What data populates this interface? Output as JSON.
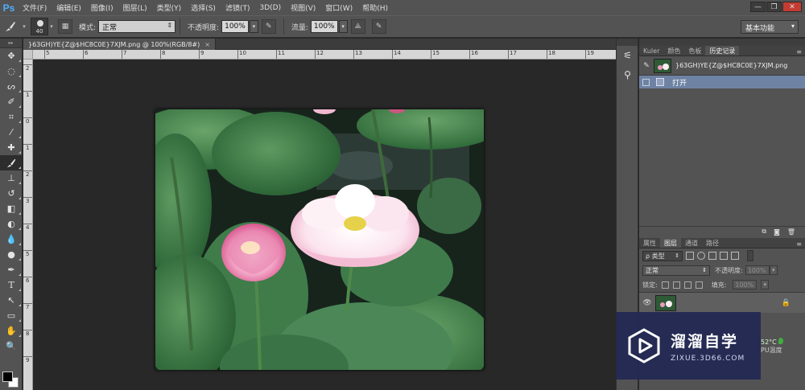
{
  "app": {
    "logo": "Ps"
  },
  "menu": {
    "items": [
      "文件(F)",
      "编辑(E)",
      "图像(I)",
      "图层(L)",
      "类型(Y)",
      "选择(S)",
      "滤镜(T)",
      "3D(D)",
      "视图(V)",
      "窗口(W)",
      "帮助(H)"
    ]
  },
  "window_controls": {
    "minimize": "—",
    "restore": "❐",
    "close": "✕"
  },
  "options_bar": {
    "brush_size": "40",
    "mode_label": "模式:",
    "mode_value": "正常",
    "opacity_label": "不透明度:",
    "opacity_value": "100%",
    "flow_label": "流量:",
    "flow_value": "100%",
    "workspace": "基本功能"
  },
  "document": {
    "tab_title": "}63GH)YE{Z@$HC8C0E}7XJM.png @ 100%(RGB/8#)",
    "tab_close": "×",
    "ruler_h": [
      "5",
      "6",
      "7",
      "8",
      "9",
      "10",
      "11",
      "12",
      "13",
      "14",
      "15",
      "16",
      "17",
      "18",
      "19"
    ],
    "ruler_v": [
      "2",
      "1",
      "0",
      "1",
      "2",
      "3",
      "4",
      "5",
      "6",
      "7",
      "8",
      "9"
    ]
  },
  "history_panel": {
    "tabs": [
      "Kuler",
      "颜色",
      "色板",
      "历史记录"
    ],
    "active_tab": "历史记录",
    "snapshot_name": "}63GH)YE{Z@$HC8C0E}7XJM.png",
    "steps": [
      "打开"
    ]
  },
  "layers_panel": {
    "tabs": [
      "属性",
      "图层",
      "通道",
      "路径"
    ],
    "active_tab": "图层",
    "kind_filter": "ρ 类型",
    "blend_mode": "正常",
    "opacity_label": "不透明度:",
    "opacity_value": "100%",
    "lock_label": "锁定:",
    "fill_label": "填充:",
    "fill_value": "100%"
  },
  "watermark": {
    "title": "溜溜自学",
    "subtitle": "ZIXUE.3D66.COM"
  },
  "tray_widget": {
    "temp": "52°C",
    "label": "PU温度"
  },
  "colors": {
    "ui_panel": "#535353",
    "ui_dark": "#282828",
    "history_selected": "#6e83a3",
    "watermark_bg": "#222854",
    "ps_blue": "#4fb0ff"
  }
}
